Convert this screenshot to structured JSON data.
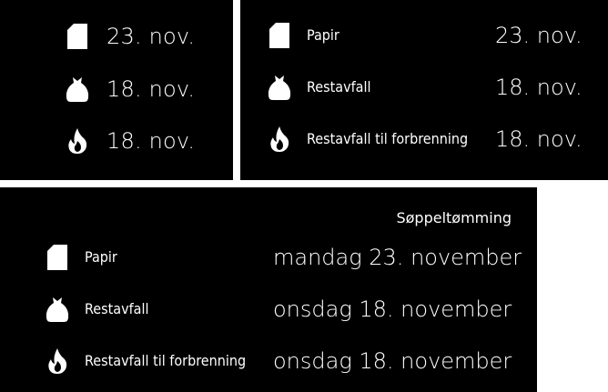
{
  "colors": {
    "panel_background": "#000000",
    "text": "#ffffff",
    "page_background": "#ffffff"
  },
  "compact": {
    "rows": [
      {
        "icon": "paper-icon",
        "date": "23. nov."
      },
      {
        "icon": "trash-bag-icon",
        "date": "18. nov."
      },
      {
        "icon": "flame-icon",
        "date": "18. nov."
      }
    ]
  },
  "medium": {
    "rows": [
      {
        "icon": "paper-icon",
        "label": "Papir",
        "date": "23. nov."
      },
      {
        "icon": "trash-bag-icon",
        "label": "Restavfall",
        "date": "18. nov."
      },
      {
        "icon": "flame-icon",
        "label": "Restavfall til forbrenning",
        "date": "18. nov."
      }
    ]
  },
  "full": {
    "header": "Søppeltømming",
    "rows": [
      {
        "icon": "paper-icon",
        "label": "Papir",
        "date": "mandag 23. november"
      },
      {
        "icon": "trash-bag-icon",
        "label": "Restavfall",
        "date": "onsdag 18. november"
      },
      {
        "icon": "flame-icon",
        "label": "Restavfall til forbrenning",
        "date": "onsdag 18. november"
      }
    ]
  }
}
